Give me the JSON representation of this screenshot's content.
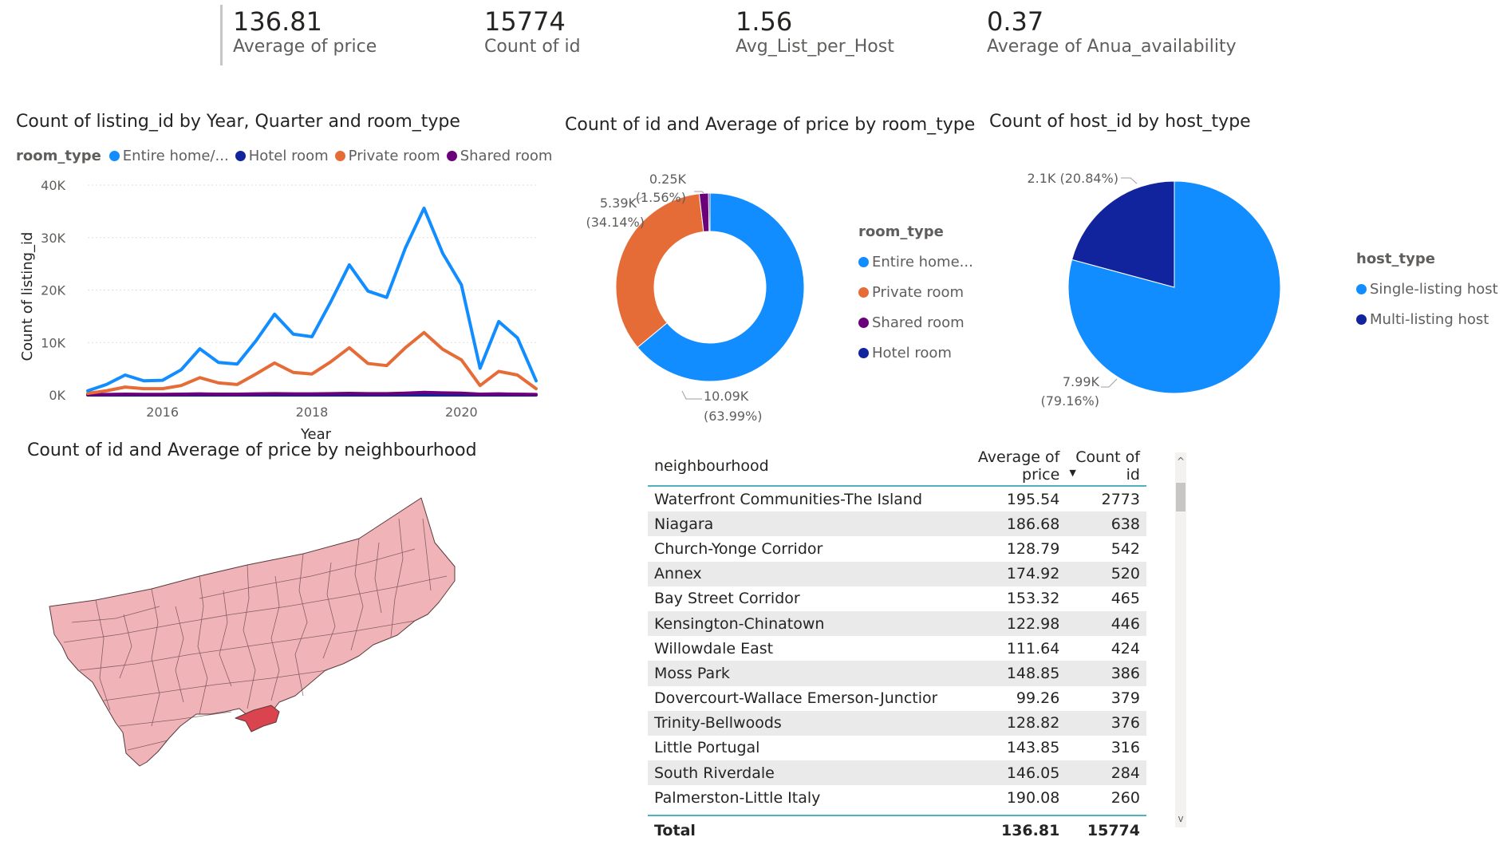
{
  "kpis": [
    {
      "value": "136.81",
      "label": "Average of price"
    },
    {
      "value": "15774",
      "label": "Count of id"
    },
    {
      "value": "1.56",
      "label": "Avg_List_per_Host"
    },
    {
      "value": "0.37",
      "label": "Average of Anua_availability"
    }
  ],
  "colors": {
    "entire": "#118DFF",
    "hotel": "#12239E",
    "private": "#E66C37",
    "shared": "#6B007B",
    "map_fill": "#f0b4b8",
    "map_highlight": "#d9444f"
  },
  "line_chart": {
    "title": "Count of listing_id by Year, Quarter and room_type",
    "legend_title": "room_type",
    "legend": [
      "Entire home/...",
      "Hotel room",
      "Private room",
      "Shared room"
    ],
    "ylabel": "Count of listing_id",
    "xlabel": "Year",
    "yticks": [
      "40K",
      "30K",
      "20K",
      "10K",
      "0K"
    ],
    "xticks": [
      "2016",
      "2018",
      "2020"
    ]
  },
  "donut_chart": {
    "title": "Count of id and Average of price by room_type",
    "legend_title": "room_type",
    "legend": [
      "Entire home...",
      "Private room",
      "Shared room",
      "Hotel room"
    ],
    "labels": {
      "entire": [
        "10.09K",
        "(63.99%)"
      ],
      "private": [
        "5.39K",
        "(34.14%)"
      ],
      "shared": [
        "0.25K",
        "(1.56%)"
      ]
    }
  },
  "pie_chart": {
    "title": "Count of host_id by host_type",
    "legend_title": "host_type",
    "legend": [
      "Single-listing host",
      "Multi-listing host"
    ],
    "labels": {
      "multi": "2.1K (20.84%)",
      "single": [
        "7.99K",
        "(79.16%)"
      ]
    }
  },
  "map": {
    "title": "Count of id and Average of price by neighbourhood"
  },
  "table": {
    "headers": [
      "neighbourhood",
      "Average of price",
      "Count of id"
    ],
    "rows": [
      [
        "Waterfront Communities-The Island",
        "195.54",
        "2773"
      ],
      [
        "Niagara",
        "186.68",
        "638"
      ],
      [
        "Church-Yonge Corridor",
        "128.79",
        "542"
      ],
      [
        "Annex",
        "174.92",
        "520"
      ],
      [
        "Bay Street Corridor",
        "153.32",
        "465"
      ],
      [
        "Kensington-Chinatown",
        "122.98",
        "446"
      ],
      [
        "Willowdale East",
        "111.64",
        "424"
      ],
      [
        "Moss Park",
        "148.85",
        "386"
      ],
      [
        "Dovercourt-Wallace Emerson-Junction",
        "99.26",
        "379"
      ],
      [
        "Trinity-Bellwoods",
        "128.82",
        "376"
      ],
      [
        "Little Portugal",
        "143.85",
        "316"
      ],
      [
        "South Riverdale",
        "146.05",
        "284"
      ],
      [
        "Palmerston-Little Italy",
        "190.08",
        "260"
      ]
    ],
    "total": [
      "Total",
      "136.81",
      "15774"
    ]
  },
  "chart_data": [
    {
      "type": "line",
      "title": "Count of listing_id by Year, Quarter and room_type",
      "xlabel": "Year",
      "ylabel": "Count of listing_id",
      "ylim": [
        0,
        40000
      ],
      "x": [
        2015.0,
        2015.25,
        2015.5,
        2015.75,
        2016.0,
        2016.25,
        2016.5,
        2016.75,
        2017.0,
        2017.25,
        2017.5,
        2017.75,
        2018.0,
        2018.25,
        2018.5,
        2018.75,
        2019.0,
        2019.25,
        2019.5,
        2019.75,
        2020.0,
        2020.25,
        2020.5,
        2020.75,
        2021.0
      ],
      "series": [
        {
          "name": "Entire home/...",
          "values": [
            800,
            2000,
            3800,
            2700,
            2800,
            4800,
            8800,
            6200,
            5900,
            10300,
            15400,
            11600,
            11100,
            17700,
            24800,
            19800,
            18600,
            28000,
            35600,
            27000,
            21000,
            5100,
            14000,
            10900,
            2700
          ]
        },
        {
          "name": "Hotel room",
          "values": [
            0,
            0,
            0,
            0,
            0,
            0,
            0,
            0,
            0,
            0,
            0,
            0,
            0,
            0,
            0,
            0,
            0,
            0,
            0,
            0,
            0,
            0,
            0,
            0,
            0
          ]
        },
        {
          "name": "Private room",
          "values": [
            300,
            800,
            1500,
            1200,
            1200,
            1800,
            3300,
            2300,
            2000,
            4000,
            6100,
            4300,
            4000,
            6300,
            9000,
            6000,
            5600,
            9000,
            11900,
            8700,
            6700,
            1800,
            4500,
            3800,
            1200
          ]
        },
        {
          "name": "Shared room",
          "values": [
            50,
            100,
            150,
            120,
            120,
            150,
            200,
            150,
            150,
            200,
            250,
            200,
            200,
            250,
            300,
            250,
            250,
            350,
            500,
            400,
            350,
            150,
            200,
            150,
            100
          ]
        }
      ]
    },
    {
      "type": "pie",
      "title": "Count of id and Average of price by room_type",
      "categories": [
        "Entire home...",
        "Private room",
        "Shared room",
        "Hotel room"
      ],
      "values": [
        10090,
        5390,
        250,
        40
      ]
    },
    {
      "type": "pie",
      "title": "Count of host_id by host_type",
      "categories": [
        "Single-listing host",
        "Multi-listing host"
      ],
      "values": [
        7990,
        2100
      ]
    }
  ]
}
